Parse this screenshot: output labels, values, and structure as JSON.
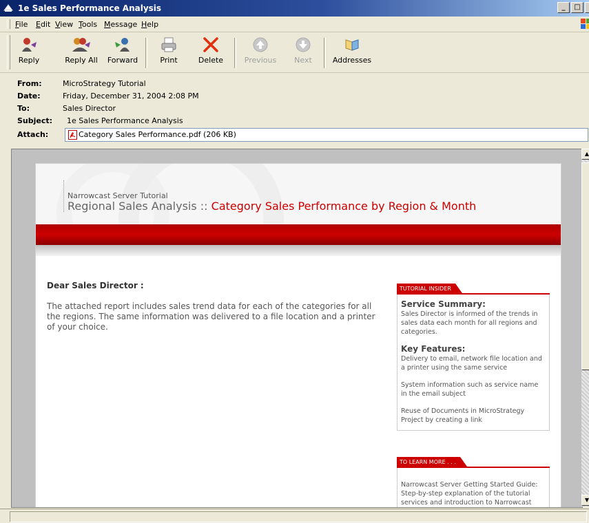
{
  "window": {
    "title": "1e Sales Performance Analysis",
    "controls": [
      "_",
      "□",
      "×"
    ]
  },
  "menu": {
    "items": [
      {
        "label": "File",
        "key": "F",
        "rest": "ile"
      },
      {
        "label": "Edit",
        "key": "E",
        "rest": "dit"
      },
      {
        "label": "View",
        "key": "V",
        "rest": "iew"
      },
      {
        "label": "Tools",
        "key": "T",
        "rest": "ools"
      },
      {
        "label": "Message",
        "key": "M",
        "rest": "essage"
      },
      {
        "label": "Help",
        "key": "H",
        "rest": "elp"
      }
    ]
  },
  "toolbar": {
    "reply": "Reply",
    "reply_all": "Reply All",
    "forward": "Forward",
    "print": "Print",
    "delete": "Delete",
    "previous": "Previous",
    "next": "Next",
    "addresses": "Addresses"
  },
  "headers": {
    "from_label": "From:",
    "from": "MicroStrategy Tutorial",
    "date_label": "Date:",
    "date": "Friday, December 31, 2004 2:08 PM",
    "to_label": "To:",
    "to": "Sales Director",
    "subject_label": "Subject:",
    "subject": "1e Sales Performance Analysis",
    "attach_label": "Attach:",
    "attachment": "Category Sales Performance.pdf (206 KB)"
  },
  "doc": {
    "tutorial": "Narrowcast Server Tutorial",
    "title_gray": "Regional Sales Analysis :: ",
    "title_red": "Category Sales Performance by Region & Month",
    "greeting": "Dear  Sales Director :",
    "body": "The attached report includes sales trend data for each of the categories for all the regions. The same information was delivered to a file location and a printer of your choice."
  },
  "sidebar": {
    "insider_tab": "TUTORIAL INSIDER",
    "summary_heading": "Service Summary:",
    "summary_text": "Sales Director is informed of the trends in sales data each month for all regions and categories.",
    "features_heading": "Key Features:",
    "feature_1": "Delivery to email, network file location and a printer using the same service",
    "feature_2": "System information such as service name in the email subject",
    "feature_3": "Reuse of Documents in MicroStrategy Project by creating a link",
    "learn_tab": "TO LEARN MORE . . .",
    "learn_text": "Narrowcast Server Getting Started Guide: Step-by-step explanation of the tutorial services and introduction to Narrowcast"
  }
}
